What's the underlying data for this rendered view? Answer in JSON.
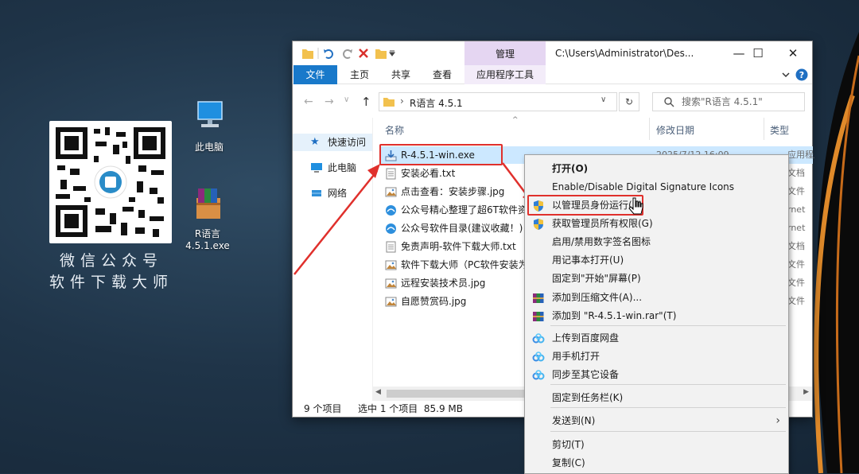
{
  "desktop": {
    "caption_line1": "微信公众号",
    "caption_line2": "软件下载大师",
    "icons": [
      {
        "label": "此电脑",
        "icon": "this-pc-icon"
      },
      {
        "label": "R语言\n4.5.1.exe",
        "icon": "winrar-archive-icon"
      }
    ]
  },
  "window": {
    "manage_tab": "管理",
    "title": "C:\\Users\\Administrator\\Des...",
    "ribbon_tabs": [
      "文件",
      "主页",
      "共享",
      "查看",
      "应用程序工具"
    ],
    "address": "R语言 4.5.1",
    "search_placeholder": "搜索\"R语言 4.5.1\"",
    "nav": [
      "快速访问",
      "此电脑",
      "网络"
    ],
    "columns": {
      "name": "名称",
      "modified": "修改日期",
      "type": "类型"
    },
    "files": [
      {
        "name": "R-4.5.1-win.exe",
        "icon": "installer-icon",
        "date": "2025/7/12 16:09",
        "type": "应用程序"
      },
      {
        "name": "安装必看.txt",
        "icon": "text-file-icon",
        "type": "文档"
      },
      {
        "name": "点击查看：安装步骤.jpg",
        "icon": "image-file-icon",
        "type": "文件"
      },
      {
        "name": "公众号精心整理了超6T软件资",
        "icon": "internet-shortcut-icon",
        "type": "rnet"
      },
      {
        "name": "公众号软件目录(建议收藏！)",
        "icon": "internet-shortcut-icon",
        "type": "rnet"
      },
      {
        "name": "免责声明-软件下载大师.txt",
        "icon": "text-file-icon",
        "type": "文档"
      },
      {
        "name": "软件下载大师（PC软件安装为",
        "icon": "image-file-icon",
        "type": "文件"
      },
      {
        "name": "远程安装技术员.jpg",
        "icon": "image-file-icon",
        "type": "文件"
      },
      {
        "name": "自愿赞赏码.jpg",
        "icon": "image-file-icon",
        "type": "文件"
      }
    ],
    "status": {
      "count": "9 个项目",
      "selection": "选中 1 个项目  85.9 MB"
    }
  },
  "context_menu": [
    {
      "label": "打开(O)",
      "bold": true
    },
    {
      "label": "Enable/Disable Digital Signature Icons"
    },
    {
      "label": "以管理员身份运行(A)",
      "icon": "uac-shield-icon",
      "highlight": true
    },
    {
      "label": "获取管理员所有权限(G)",
      "icon": "uac-shield-icon"
    },
    {
      "label": "启用/禁用数字签名图标"
    },
    {
      "label": "用记事本打开(U)"
    },
    {
      "label": "固定到\"开始\"屏幕(P)"
    },
    {
      "label": "添加到压缩文件(A)...",
      "icon": "winrar-icon"
    },
    {
      "label": "添加到 \"R-4.5.1-win.rar\"(T)",
      "icon": "winrar-icon"
    },
    {
      "label": "上传到百度网盘",
      "icon": "baidu-netdisk-icon"
    },
    {
      "label": "用手机打开",
      "icon": "baidu-netdisk-icon"
    },
    {
      "label": "同步至其它设备",
      "icon": "baidu-netdisk-icon"
    },
    {
      "label": "固定到任务栏(K)"
    },
    {
      "label": "发送到(N)",
      "submenu": true
    },
    {
      "label": "剪切(T)"
    },
    {
      "label": "复制(C)"
    }
  ],
  "colors": {
    "accent": "#1979ca",
    "annotation": "#e0302c",
    "selection": "#cce8ff",
    "manage_tab": "#e5d6f2"
  }
}
